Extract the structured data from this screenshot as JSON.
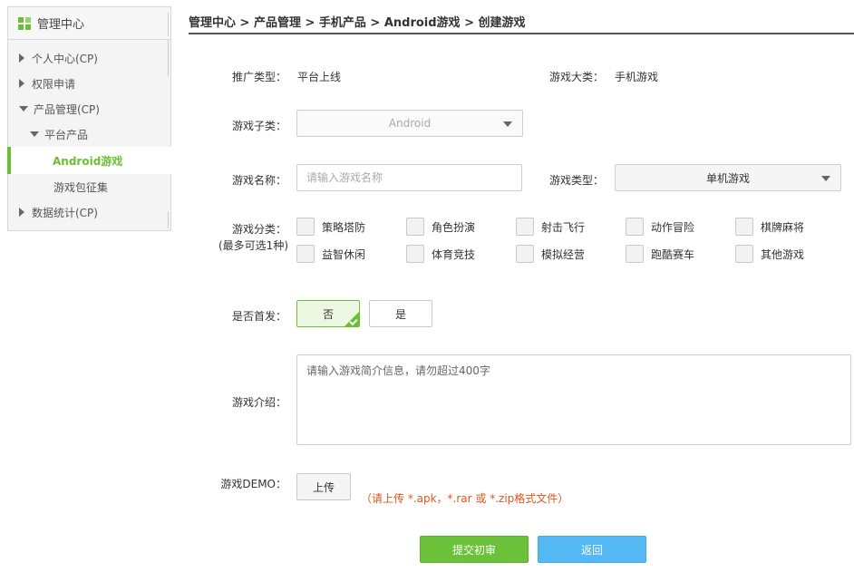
{
  "sidebar": {
    "title": "管理中心",
    "items": [
      {
        "label": "个人中心(CP)"
      },
      {
        "label": "权限申请"
      },
      {
        "label": "产品管理(CP)"
      },
      {
        "label": "平台产品"
      },
      {
        "label": "Android游戏"
      },
      {
        "label": "游戏包征集"
      },
      {
        "label": "数据统计(CP)"
      }
    ]
  },
  "breadcrumb": "管理中心 > 产品管理 > 手机产品 > Android游戏 > 创建游戏",
  "form": {
    "promo_type_label": "推广类型：",
    "promo_type_value": "平台上线",
    "game_category_label": "游戏大类：",
    "game_category_value": "手机游戏",
    "sub_type_label": "游戏子类：",
    "sub_type_value": "Android",
    "name_label": "游戏名称：",
    "name_placeholder": "请输入游戏名称",
    "game_type_label": "游戏类型：",
    "game_type_value": "单机游戏",
    "classify_label": "游戏分类：",
    "classify_note": "(最多可选1种)",
    "classify_options": [
      "策略塔防",
      "角色扮演",
      "射击飞行",
      "动作冒险",
      "棋牌麻将",
      "益智休闲",
      "体育竞技",
      "模拟经营",
      "跑酷赛车",
      "其他游戏"
    ],
    "first_release_label": "是否首发：",
    "first_release_no": "否",
    "first_release_yes": "是",
    "intro_label": "游戏介绍：",
    "intro_placeholder": "请输入游戏简介信息，请勿超过400字",
    "demo_label": "游戏DEMO：",
    "upload_label": "上传",
    "upload_hint": "（请上传 *.apk，*.rar 或 *.zip格式文件）",
    "submit_label": "提交初审",
    "back_label": "返回"
  },
  "colors": {
    "accent_green": "#6cbf35",
    "button_blue": "#53b8f3",
    "hint_orange": "#e2541b"
  }
}
